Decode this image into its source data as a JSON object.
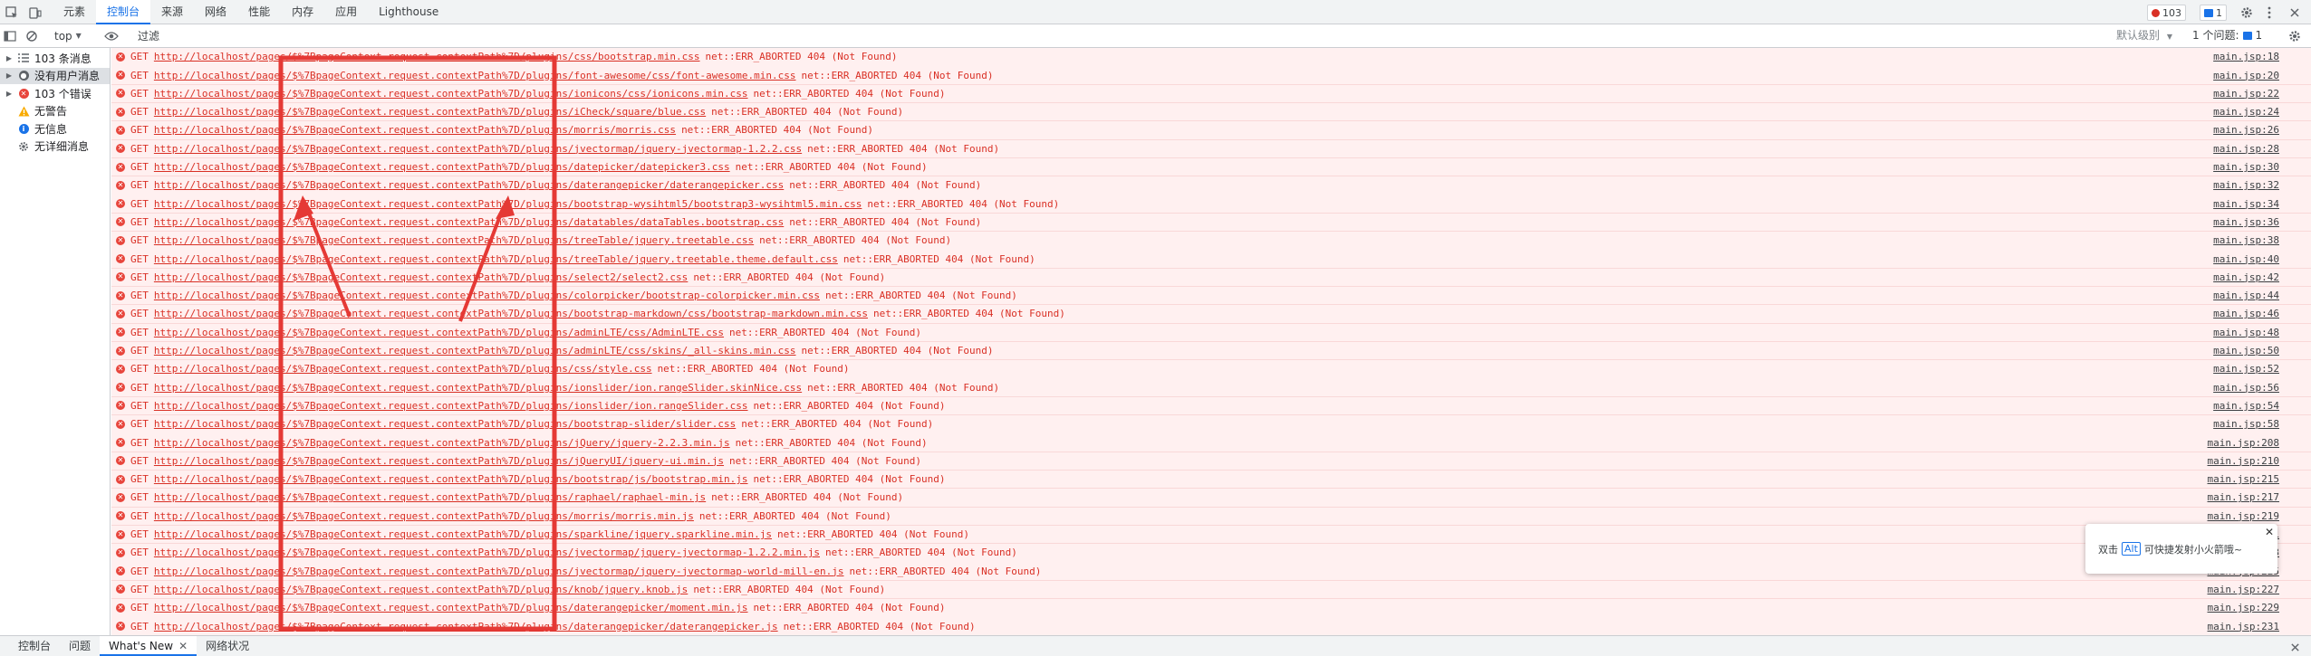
{
  "tabs": [
    "元素",
    "控制台",
    "来源",
    "网络",
    "性能",
    "内存",
    "应用",
    "Lighthouse"
  ],
  "active_tab": "控制台",
  "counters": {
    "errors": "103",
    "messages": "1"
  },
  "filterbar": {
    "context": "top",
    "filter_placeholder": "过滤",
    "levels": "默认级别",
    "issues_label": "1 个问题:",
    "issues_count": "1"
  },
  "sidebar": {
    "items": [
      {
        "label": "103 条消息",
        "icon": "list-icon"
      },
      {
        "label": "没有用户消息",
        "icon": "user-icon"
      },
      {
        "label": "103 个错误",
        "icon": "error-icon"
      },
      {
        "label": "无警告",
        "icon": "warning-icon"
      },
      {
        "label": "无信息",
        "icon": "info-icon"
      },
      {
        "label": "无详细消息",
        "icon": "gear-icon"
      }
    ]
  },
  "console": {
    "method": "GET",
    "url_prefix": "http://localhost/pages/$%7BpageContext.request.contextPath%7D/plugins/",
    "rows": [
      {
        "path": "css/bootstrap.min.css",
        "error": "net::ERR_ABORTED 404 (Not Found)",
        "source": "main.jsp:18"
      },
      {
        "path": "font-awesome/css/font-awesome.min.css",
        "error": "net::ERR_ABORTED 404 (Not Found)",
        "source": "main.jsp:20"
      },
      {
        "path": "ionicons/css/ionicons.min.css",
        "error": "net::ERR_ABORTED 404 (Not Found)",
        "source": "main.jsp:22"
      },
      {
        "path": "iCheck/square/blue.css",
        "error": "net::ERR_ABORTED 404 (Not Found)",
        "source": "main.jsp:24"
      },
      {
        "path": "morris/morris.css",
        "error": "net::ERR_ABORTED 404 (Not Found)",
        "source": "main.jsp:26"
      },
      {
        "path": "jvectormap/jquery-jvectormap-1.2.2.css",
        "error": "net::ERR_ABORTED 404 (Not Found)",
        "source": "main.jsp:28"
      },
      {
        "path": "datepicker/datepicker3.css",
        "error": "net::ERR_ABORTED 404 (Not Found)",
        "source": "main.jsp:30"
      },
      {
        "path": "daterangepicker/daterangepicker.css",
        "error": "net::ERR_ABORTED 404 (Not Found)",
        "source": "main.jsp:32"
      },
      {
        "path": "bootstrap-wysihtml5/bootstrap3-wysihtml5.min.css",
        "error": "net::ERR_ABORTED 404 (Not Found)",
        "source": "main.jsp:34"
      },
      {
        "path": "datatables/dataTables.bootstrap.css",
        "error": "net::ERR_ABORTED 404 (Not Found)",
        "source": "main.jsp:36"
      },
      {
        "path": "treeTable/jquery.treetable.css",
        "error": "net::ERR_ABORTED 404 (Not Found)",
        "source": "main.jsp:38"
      },
      {
        "path": "treeTable/jquery.treetable.theme.default.css",
        "error": "net::ERR_ABORTED 404 (Not Found)",
        "source": "main.jsp:40"
      },
      {
        "path": "select2/select2.css",
        "error": "net::ERR_ABORTED 404 (Not Found)",
        "source": "main.jsp:42"
      },
      {
        "path": "colorpicker/bootstrap-colorpicker.min.css",
        "error": "net::ERR_ABORTED 404 (Not Found)",
        "source": "main.jsp:44"
      },
      {
        "path": "bootstrap-markdown/css/bootstrap-markdown.min.css",
        "error": "net::ERR_ABORTED 404 (Not Found)",
        "source": "main.jsp:46"
      },
      {
        "path": "adminLTE/css/AdminLTE.css",
        "error": "net::ERR_ABORTED 404 (Not Found)",
        "source": "main.jsp:48"
      },
      {
        "path": "adminLTE/css/skins/_all-skins.min.css",
        "error": "net::ERR_ABORTED 404 (Not Found)",
        "source": "main.jsp:50"
      },
      {
        "path": "css/style.css",
        "error": "net::ERR_ABORTED 404 (Not Found)",
        "source": "main.jsp:52"
      },
      {
        "path": "ionslider/ion.rangeSlider.skinNice.css",
        "error": "net::ERR_ABORTED 404 (Not Found)",
        "source": "main.jsp:56"
      },
      {
        "path": "ionslider/ion.rangeSlider.css",
        "error": "net::ERR_ABORTED 404 (Not Found)",
        "source": "main.jsp:54"
      },
      {
        "path": "bootstrap-slider/slider.css",
        "error": "net::ERR_ABORTED 404 (Not Found)",
        "source": "main.jsp:58"
      },
      {
        "path": "jQuery/jquery-2.2.3.min.js",
        "error": "net::ERR_ABORTED 404 (Not Found)",
        "source": "main.jsp:208"
      },
      {
        "path": "jQueryUI/jquery-ui.min.js",
        "error": "net::ERR_ABORTED 404 (Not Found)",
        "source": "main.jsp:210"
      },
      {
        "path": "bootstrap/js/bootstrap.min.js",
        "error": "net::ERR_ABORTED 404 (Not Found)",
        "source": "main.jsp:215"
      },
      {
        "path": "raphael/raphael-min.js",
        "error": "net::ERR_ABORTED 404 (Not Found)",
        "source": "main.jsp:217"
      },
      {
        "path": "morris/morris.min.js",
        "error": "net::ERR_ABORTED 404 (Not Found)",
        "source": "main.jsp:219"
      },
      {
        "path": "sparkline/jquery.sparkline.min.js",
        "error": "net::ERR_ABORTED 404 (Not Found)",
        "source": "main.jsp:221"
      },
      {
        "path": "jvectormap/jquery-jvectormap-1.2.2.min.js",
        "error": "net::ERR_ABORTED 404 (Not Found)",
        "source": "main.jsp:223"
      },
      {
        "path": "jvectormap/jquery-jvectormap-world-mill-en.js",
        "error": "net::ERR_ABORTED 404 (Not Found)",
        "source": "main.jsp:225"
      },
      {
        "path": "knob/jquery.knob.js",
        "error": "net::ERR_ABORTED 404 (Not Found)",
        "source": "main.jsp:227"
      },
      {
        "path": "daterangepicker/moment.min.js",
        "error": "net::ERR_ABORTED 404 (Not Found)",
        "source": "main.jsp:229"
      },
      {
        "path": "daterangepicker/daterangepicker.js",
        "error": "net::ERR_ABORTED 404 (Not Found)",
        "source": "main.jsp:231"
      }
    ]
  },
  "ime_tooltip": {
    "prefix": "双击",
    "key": "Alt",
    "suffix": "可快捷发射小火箭哦~"
  },
  "drawer": {
    "tabs": [
      "控制台",
      "问题",
      "What's New",
      "网络状况"
    ],
    "active_tab": "What's New"
  },
  "colors": {
    "error": "#d93025",
    "annotation": "#e53935",
    "accent": "#1a73e8"
  }
}
